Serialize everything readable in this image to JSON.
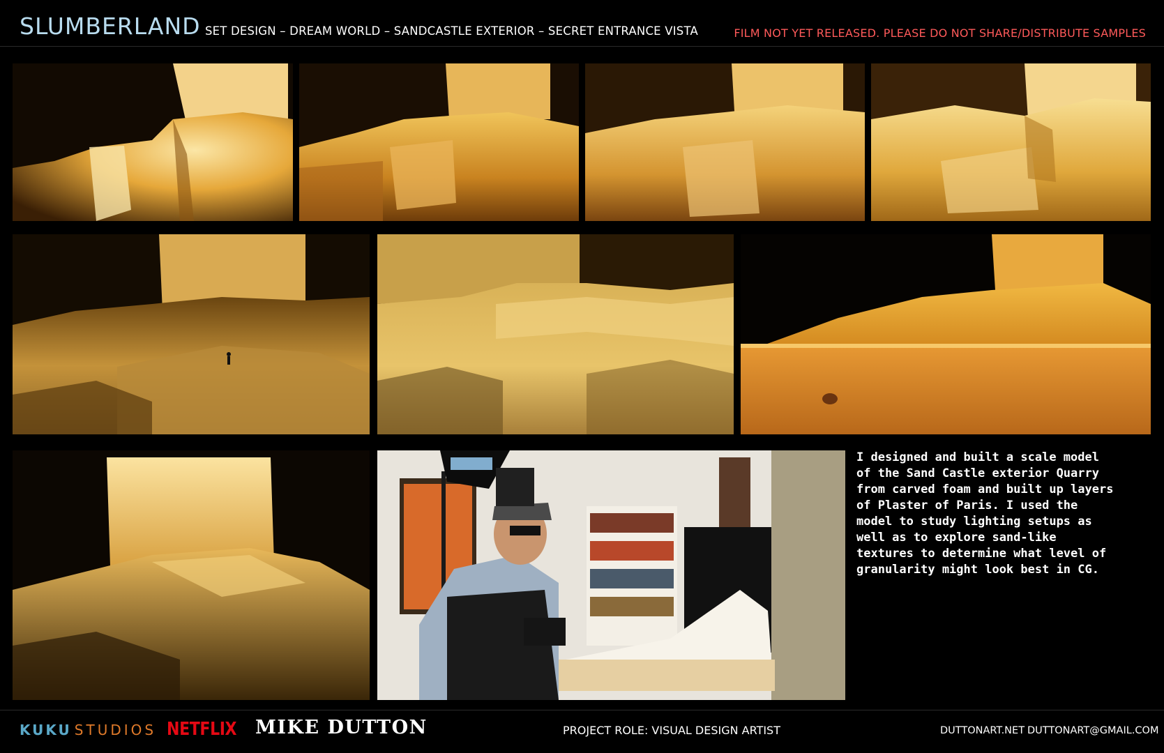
{
  "header": {
    "logo": "SLUMBERLAND",
    "subtitle": "SET DESIGN – DREAM WORLD –  SANDCASTLE EXTERIOR – SECRET ENTRANCE VISTA",
    "warning": "FILM NOT YET RELEASED. PLEASE DO NOT SHARE/DISTRIBUTE SAMPLES"
  },
  "gallery": {
    "photos": [
      "sandcastle-model-closeup-1",
      "sandcastle-model-closeup-2",
      "sandcastle-model-closeup-3",
      "sandcastle-model-closeup-4",
      "sandcastle-model-tiny-figure",
      "sandcastle-model-dunes",
      "sandcastle-model-on-wood-base",
      "sandcastle-model-tower",
      "artist-photographing-model"
    ]
  },
  "description": "I designed and built a scale model\nof the Sand Castle exterior Quarry\nfrom carved foam and built up layers\nof Plaster of Paris. I used the\nmodel to study lighting setups as\nwell as to explore sand-like\ntextures to determine what level of\ngranularity might look best in CG.",
  "footer": {
    "studio_part1": "KUKU",
    "studio_part2": "STUDIOS",
    "network": "NETFLIX",
    "artist": "MIKE DUTTON",
    "role": "PROJECT ROLE: VISUAL DESIGN ARTIST",
    "website": "DUTTONART.NET",
    "email": "DUTTONART@GMAIL.COM"
  },
  "colors": {
    "logo": "#b9dcef",
    "warning": "#ff5a5a",
    "netflix": "#e50914",
    "sand_light": "#f5d98a",
    "sand_mid": "#d99a2a",
    "sand_dark": "#3a2208"
  }
}
